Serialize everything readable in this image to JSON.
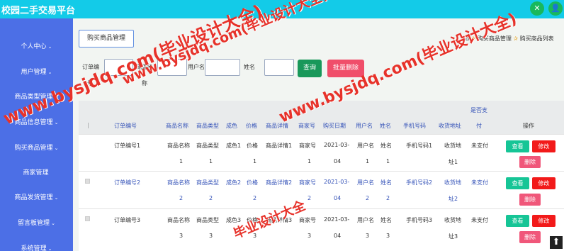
{
  "app": {
    "title": "校园二手交易平台",
    "icon_left": "✕",
    "icon_right": "👤"
  },
  "sidebar": {
    "items": [
      {
        "label": "个人中心",
        "chevron": "⌄"
      },
      {
        "label": "用户管理",
        "chevron": "⌄"
      },
      {
        "label": "商品类型管理",
        "chevron": "⌄"
      },
      {
        "label": "商品信息管理",
        "chevron": "⌄"
      },
      {
        "label": "购买商品管理",
        "chevron": "⌄"
      },
      {
        "label": "商家管理",
        "chevron": ""
      },
      {
        "label": "商品发货管理",
        "chevron": "⌄"
      },
      {
        "label": "留言板管理",
        "chevron": "⌄"
      },
      {
        "label": "系统管理",
        "chevron": "⌄"
      }
    ]
  },
  "main": {
    "tab_label": "购买商品管理",
    "breadcrumb": {
      "home_icon": "⌂",
      "sep_icon": "✰",
      "item1": "购买商品管理",
      "item2": "购买商品列表"
    }
  },
  "filters": {
    "order_no_label_1": "订单编",
    "order_no_label_2": "号",
    "product_name_label_1": "商品名",
    "product_name_label_2": "称",
    "username_label": "用户名",
    "name_label": "姓名",
    "query_button": "查询",
    "batch_delete_button": "批量删除"
  },
  "table": {
    "index_header": "|",
    "headers": {
      "order_no": "订单编号",
      "product_name": "商品名称",
      "product_type": "商品类型",
      "color": "成色",
      "price": "价格",
      "detail": "商品详情",
      "merchant_no": "商家号",
      "purchase_date": "购买日期",
      "username": "用户名",
      "name": "姓名",
      "phone": "手机号码",
      "address": "收货地址",
      "paid_1": "是否支",
      "paid_2": "付",
      "actions": "操作"
    },
    "rows": [
      {
        "order_no": "订单编号1",
        "product_name_1": "商品名称",
        "product_name_2": "1",
        "product_type_1": "商品类型",
        "product_type_2": "1",
        "color_1": "成色1",
        "color_2": "",
        "price_1": "价格",
        "price_2": "1",
        "detail": "商品详情1",
        "merchant_no_1": "商家号",
        "merchant_no_2": "1",
        "date_1": "2021-03-",
        "date_2": "04",
        "username_1": "用户名",
        "username_2": "1",
        "name_1": "姓名",
        "name_2": "1",
        "phone": "手机号码1",
        "address_1": "收货地",
        "address_2": "址1",
        "paid": "未支付"
      },
      {
        "order_no": "订单编号2",
        "product_name_1": "商品名称",
        "product_name_2": "2",
        "product_type_1": "商品类型",
        "product_type_2": "2",
        "color_1": "成色2",
        "color_2": "",
        "price_1": "价格",
        "price_2": "2",
        "detail": "商品详情2",
        "merchant_no_1": "商家号",
        "merchant_no_2": "2",
        "date_1": "2021-03-",
        "date_2": "04",
        "username_1": "用户名",
        "username_2": "2",
        "name_1": "姓名",
        "name_2": "2",
        "phone": "手机号码2",
        "address_1": "收货地",
        "address_2": "址2",
        "paid": "未支付"
      },
      {
        "order_no": "订单编号3",
        "product_name_1": "商品名称",
        "product_name_2": "3",
        "product_type_1": "商品类型",
        "product_type_2": "3",
        "color_1": "成色3",
        "color_2": "",
        "price_1": "价格",
        "price_2": "3",
        "detail": "商品详情3",
        "merchant_no_1": "商家号",
        "merchant_no_2": "3",
        "date_1": "2021-03-",
        "date_2": "04",
        "username_1": "用户名",
        "username_2": "3",
        "name_1": "姓名",
        "name_2": "3",
        "phone": "手机号码3",
        "address_1": "收货地",
        "address_2": "址3",
        "paid": "未支付"
      }
    ],
    "action_labels": {
      "view": "查看",
      "edit": "修改",
      "delete": "删除"
    }
  },
  "watermark": {
    "text_1": "www.bysjdq.com(毕业设计大全)",
    "text_2": "www.bysjdq.com(毕业设计大全)",
    "text_3": "www.bysjdq.com(毕业设计大全)",
    "text_4": "毕业设计大全"
  },
  "scroll_top_icon": "⬆"
}
